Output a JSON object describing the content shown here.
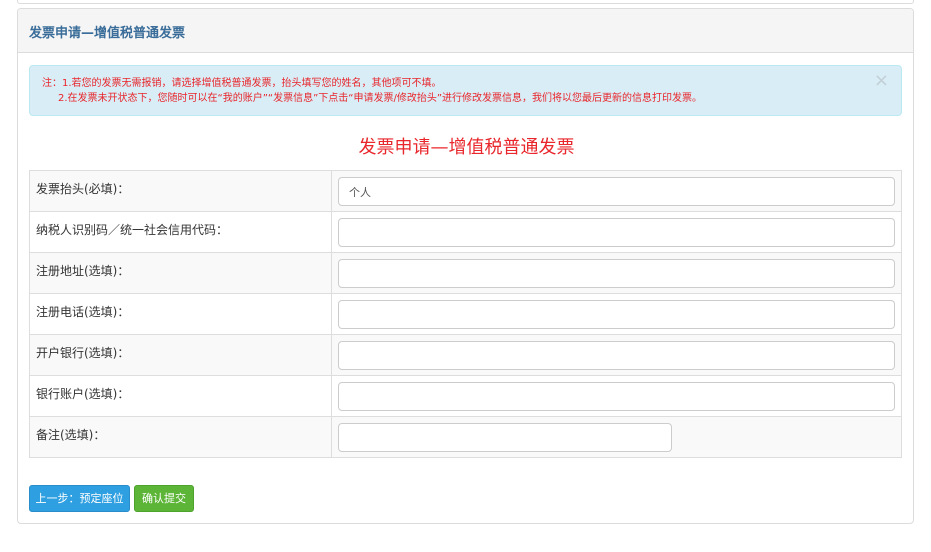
{
  "panel": {
    "title": "发票申请—增值税普通发票"
  },
  "notice": {
    "line1": "注：1.若您的发票无需报销，请选择增值税普通发票，抬头填写您的姓名，其他项可不填。",
    "line2": "2.在发票未开状态下，您随时可以在“我的账户”“发票信息”下点击“申请发票/修改抬头”进行修改发票信息，我们将以您最后更新的信息打印发票。",
    "close_glyph": "×"
  },
  "form": {
    "title": "发票申请—增值税普通发票",
    "rows": [
      {
        "label": "发票抬头(必填)：",
        "value": "个人"
      },
      {
        "label": "纳税人识别码／统一社会信用代码：",
        "value": ""
      },
      {
        "label": "注册地址(选填)：",
        "value": ""
      },
      {
        "label": "注册电话(选填)：",
        "value": ""
      },
      {
        "label": "开户银行(选填)：",
        "value": ""
      },
      {
        "label": "银行账户(选填)：",
        "value": ""
      },
      {
        "label": "备注(选填)：",
        "value": ""
      }
    ]
  },
  "buttons": {
    "prev": "上一步：预定座位",
    "submit": "确认提交"
  },
  "colors": {
    "heading_text": "#3a6d99",
    "notice_text": "#e8262b",
    "notice_bg": "#d9edf7",
    "prev_button": "#2e9fe0",
    "submit_button": "#5cb536"
  }
}
